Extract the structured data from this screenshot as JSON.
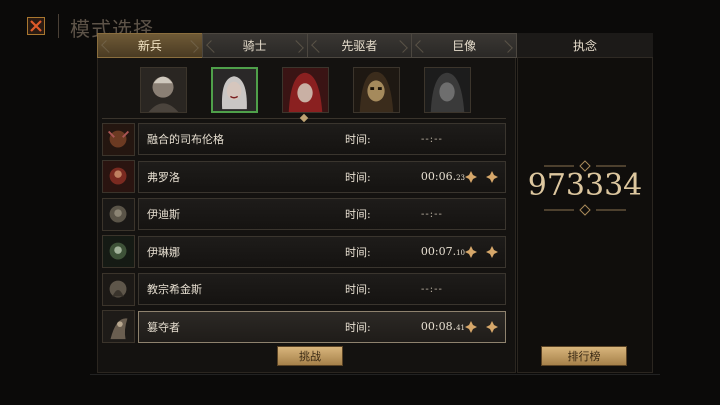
{
  "header": {
    "title": "模式选择",
    "close_icon": "close-x-icon"
  },
  "tabs": [
    {
      "label": "新兵",
      "active": true
    },
    {
      "label": "骑士",
      "active": false
    },
    {
      "label": "先驱者",
      "active": false
    },
    {
      "label": "巨像",
      "active": false
    }
  ],
  "portraits": [
    {
      "name": "old-man-portrait",
      "selected": false
    },
    {
      "name": "white-hair-woman-portrait",
      "selected": true
    },
    {
      "name": "red-hood-portrait",
      "selected": false
    },
    {
      "name": "masked-hood-portrait",
      "selected": false
    },
    {
      "name": "grey-hood-portrait",
      "selected": false
    }
  ],
  "boss_list": {
    "time_label": "时间:",
    "rows": [
      {
        "name": "融合的司布伦格",
        "time_main": "",
        "time_ms": "",
        "empty_time": "--:--",
        "has_ranks": false
      },
      {
        "name": "弗罗洛",
        "time_main": "00:06.",
        "time_ms": "23",
        "empty_time": "",
        "has_ranks": true
      },
      {
        "name": "伊迪斯",
        "time_main": "",
        "time_ms": "",
        "empty_time": "--:--",
        "has_ranks": false
      },
      {
        "name": "伊琳娜",
        "time_main": "00:07.",
        "time_ms": "10",
        "empty_time": "",
        "has_ranks": true
      },
      {
        "name": "教宗希金斯",
        "time_main": "",
        "time_ms": "",
        "empty_time": "--:--",
        "has_ranks": false
      },
      {
        "name": "篡夺者",
        "time_main": "00:08.",
        "time_ms": "41",
        "empty_time": "",
        "has_ranks": true
      }
    ]
  },
  "buttons": {
    "challenge": "挑战",
    "ranking": "排行榜"
  },
  "side": {
    "tab_label": "执念",
    "score": "973334"
  },
  "colors": {
    "accent_gold": "#ddc79f",
    "selected_border": "#4fa04a",
    "active_tab": "#6f5a36"
  }
}
